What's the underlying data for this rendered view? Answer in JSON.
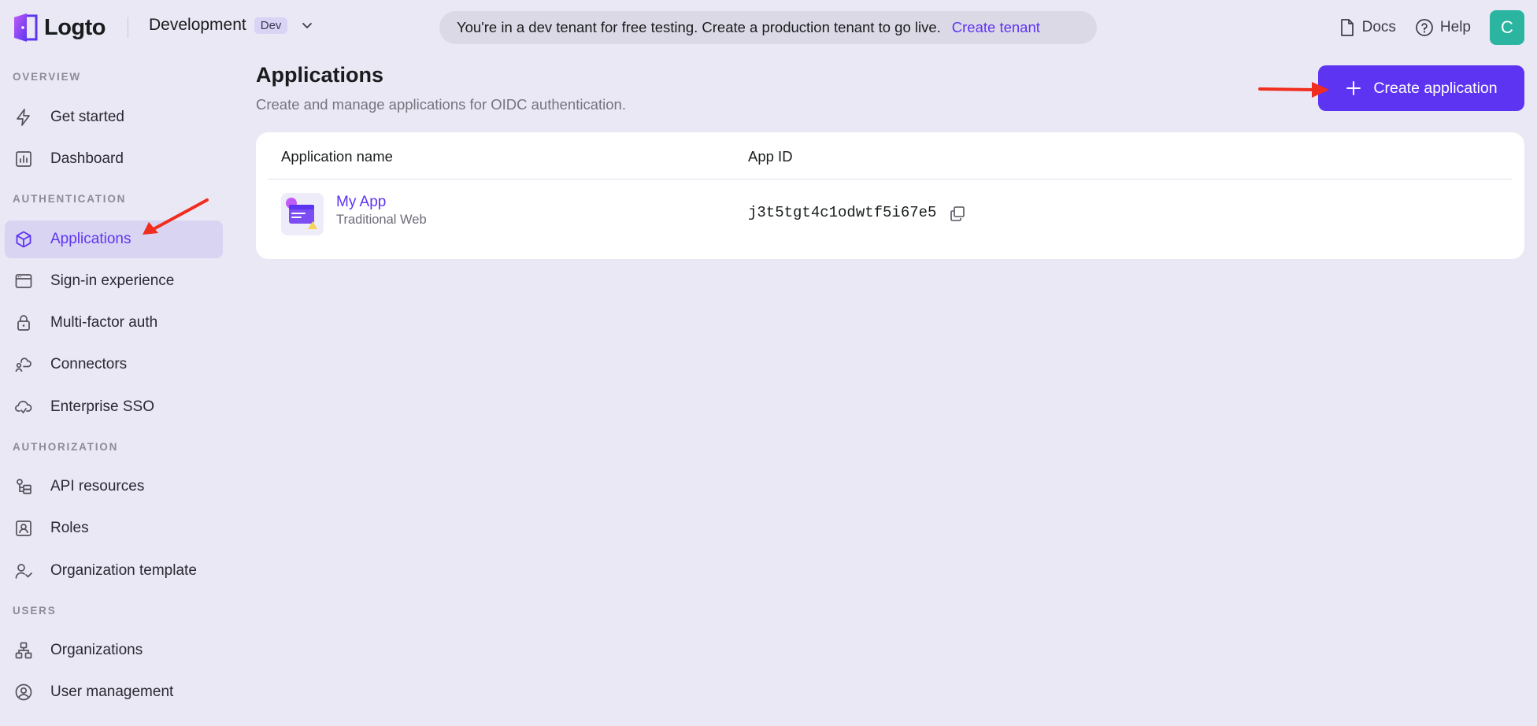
{
  "brand": {
    "name": "Logto",
    "accent": "#5d34f2"
  },
  "tenant": {
    "name": "Development",
    "badge": "Dev"
  },
  "banner": {
    "message": "You're in a dev tenant for free testing. Create a production tenant to go live.",
    "link": "Create tenant"
  },
  "topnav": {
    "docs": "Docs",
    "help": "Help",
    "avatar_initial": "C"
  },
  "sidebar": {
    "sections": [
      {
        "title": "OVERVIEW"
      },
      {
        "title": "AUTHENTICATION"
      },
      {
        "title": "AUTHORIZATION"
      },
      {
        "title": "USERS"
      }
    ],
    "items": [
      {
        "label": "Get started",
        "icon": "lightning-icon"
      },
      {
        "label": "Dashboard",
        "icon": "bar-chart-icon"
      },
      {
        "label": "Applications",
        "icon": "cube-icon",
        "active": true
      },
      {
        "label": "Sign-in experience",
        "icon": "browser-window-icon"
      },
      {
        "label": "Multi-factor auth",
        "icon": "lock-icon"
      },
      {
        "label": "Connectors",
        "icon": "connectors-icon"
      },
      {
        "label": "Enterprise SSO",
        "icon": "cloud-icon"
      },
      {
        "label": "API resources",
        "icon": "api-resources-icon"
      },
      {
        "label": "Roles",
        "icon": "user-badge-icon"
      },
      {
        "label": "Organization template",
        "icon": "user-check-icon"
      },
      {
        "label": "Organizations",
        "icon": "org-tree-icon"
      },
      {
        "label": "User management",
        "icon": "user-circle-icon"
      }
    ]
  },
  "page": {
    "title": "Applications",
    "subtitle": "Create and manage applications for OIDC authentication.",
    "create_label": "Create application"
  },
  "table": {
    "columns": [
      "Application name",
      "App ID"
    ],
    "rows": [
      {
        "name": "My App",
        "type": "Traditional Web",
        "app_id": "j3t5tgt4c1odwtf5i67e5"
      }
    ]
  }
}
